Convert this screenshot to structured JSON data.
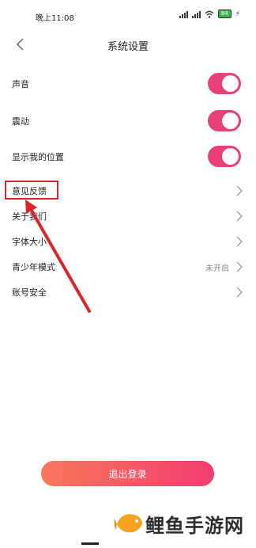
{
  "status_bar": {
    "time": "晚上11:08",
    "battery": "84"
  },
  "header": {
    "title": "系统设置"
  },
  "toggles": [
    {
      "label": "声音",
      "enabled": true
    },
    {
      "label": "震动",
      "enabled": true
    },
    {
      "label": "显示我的位置",
      "enabled": true
    }
  ],
  "menu": [
    {
      "label": "意见反馈",
      "value": ""
    },
    {
      "label": "关于我们",
      "value": ""
    },
    {
      "label": "字体大小",
      "value": ""
    },
    {
      "label": "青少年模式",
      "value": "未开启"
    },
    {
      "label": "账号安全",
      "value": ""
    }
  ],
  "logout_label": "退出登录",
  "watermark": {
    "text": "鲤鱼手游网"
  },
  "colors": {
    "accent": "#e9407a",
    "annotation": "#d8262a",
    "gradient_start": "#f8785a",
    "gradient_end": "#f23d70"
  }
}
